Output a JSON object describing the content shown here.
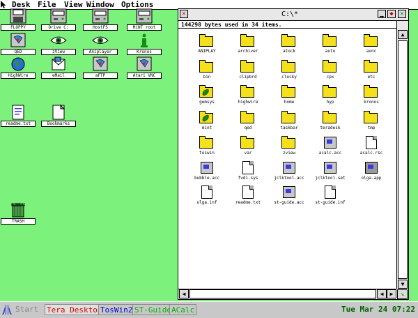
{
  "menubar": {
    "items": [
      "Desk",
      "File",
      "View",
      "Window",
      "Options"
    ]
  },
  "desktop_icons": [
    {
      "label": "FLOPPY",
      "icon": "floppy-drive-icon"
    },
    {
      "label": "Drive C:",
      "icon": "hard-drive-icon"
    },
    {
      "label": "HostFS",
      "icon": "hard-drive-icon"
    },
    {
      "label": "MiNT root",
      "icon": "hard-drive-icon"
    },
    {
      "label": "QED",
      "icon": "qed-app-icon"
    },
    {
      "label": "zView",
      "icon": "eye-icon"
    },
    {
      "label": "Aniplayer",
      "icon": "eye-icon"
    },
    {
      "label": "Kronos",
      "icon": "info-icon"
    },
    {
      "label": "HighWire",
      "icon": "globe-icon"
    },
    {
      "label": "eMail",
      "icon": "letter-icon"
    },
    {
      "label": "aFTP",
      "icon": "ftp-app-icon"
    },
    {
      "label": "Atari VNC",
      "icon": "vnc-app-icon"
    },
    {
      "label": "readme.txt",
      "icon": "text-document-icon"
    },
    {
      "label": "Bookmarks",
      "icon": "document-icon"
    },
    {
      "label": "TRASH",
      "icon": "trash-icon"
    }
  ],
  "window": {
    "title": "C:\\*",
    "info": "144298 bytes used in 34 items.",
    "files": [
      {
        "name": "ANIPLAY",
        "type": "folder"
      },
      {
        "name": "archiver",
        "type": "folder"
      },
      {
        "name": "atock",
        "type": "folder"
      },
      {
        "name": "auto",
        "type": "folder"
      },
      {
        "name": "avnc",
        "type": "folder"
      },
      {
        "name": "bin",
        "type": "folder"
      },
      {
        "name": "clipbrd",
        "type": "folder"
      },
      {
        "name": "clocky",
        "type": "folder"
      },
      {
        "name": "cpx",
        "type": "folder"
      },
      {
        "name": "etc",
        "type": "folder"
      },
      {
        "name": "gemsys",
        "type": "folder-special"
      },
      {
        "name": "highwire",
        "type": "folder"
      },
      {
        "name": "home",
        "type": "folder"
      },
      {
        "name": "hyp",
        "type": "folder"
      },
      {
        "name": "kronos",
        "type": "folder"
      },
      {
        "name": "mint",
        "type": "folder-special"
      },
      {
        "name": "qed",
        "type": "folder"
      },
      {
        "name": "taskbar",
        "type": "folder"
      },
      {
        "name": "teradesk",
        "type": "folder"
      },
      {
        "name": "tmp",
        "type": "folder"
      },
      {
        "name": "toswin",
        "type": "folder"
      },
      {
        "name": "var",
        "type": "folder"
      },
      {
        "name": "zview",
        "type": "folder"
      },
      {
        "name": "acalc.acc",
        "type": "program"
      },
      {
        "name": "acalc.rsc",
        "type": "document"
      },
      {
        "name": "bubble.acc",
        "type": "program"
      },
      {
        "name": "fvdi.sys",
        "type": "document"
      },
      {
        "name": "jclktool.acc",
        "type": "program"
      },
      {
        "name": "jclktool.set",
        "type": "program"
      },
      {
        "name": "olga.app",
        "type": "program-gray"
      },
      {
        "name": "olga.inf",
        "type": "document"
      },
      {
        "name": "readme.txt",
        "type": "document"
      },
      {
        "name": "st-guide.acc",
        "type": "program"
      },
      {
        "name": "st-guide.inf",
        "type": "document"
      }
    ]
  },
  "taskbar": {
    "start_label": "Start",
    "tasks": [
      {
        "label": "Tera Desktop",
        "color": "#d40000"
      },
      {
        "label": "TosWin2",
        "color": "#0000c8"
      },
      {
        "label": "ST-Guide",
        "color": "#00b000"
      },
      {
        "label": "ACalc",
        "color": "#00b000"
      }
    ],
    "clock": "Tue Mar 24 07:22"
  },
  "colors": {
    "desktop": "#7cf27c",
    "folder": "#f5e11a",
    "clock": "#006400"
  }
}
